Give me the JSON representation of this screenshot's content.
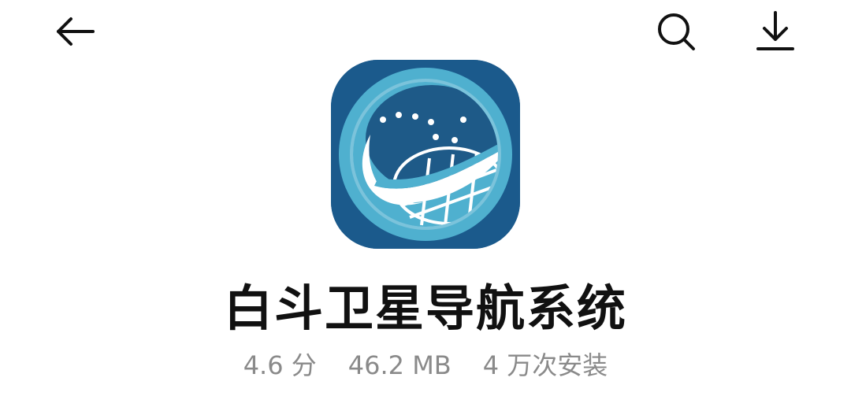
{
  "header": {
    "back_icon": "arrow-left-icon",
    "search_icon": "search-icon",
    "download_icon": "download-icon"
  },
  "app": {
    "icon": "beidou-globe-icon",
    "name": "白斗卫星导航系统",
    "rating": "4.6 分",
    "size": "46.2 MB",
    "installs": "4 万次安装"
  },
  "colors": {
    "icon_dark_blue": "#1b5a8c",
    "icon_light_blue": "#4fb0cf",
    "text_primary": "#111111",
    "text_secondary": "#8a8a8a"
  }
}
